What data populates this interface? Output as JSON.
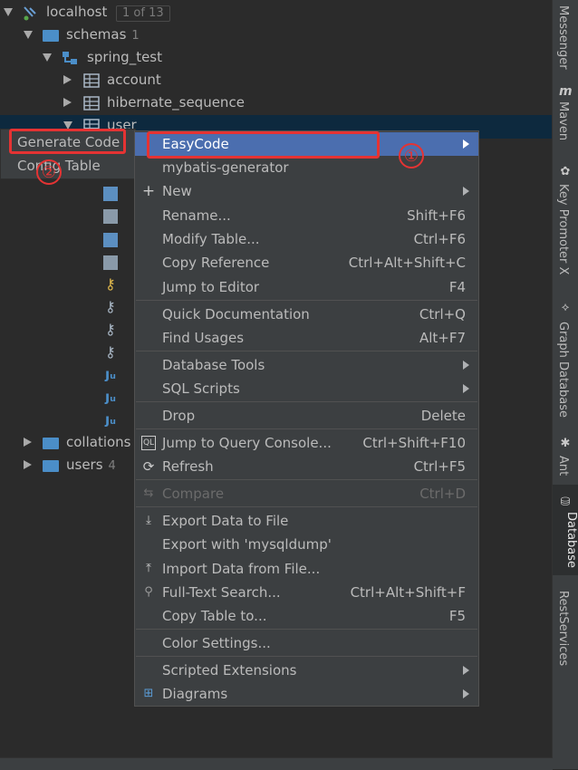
{
  "tree": {
    "root": {
      "label": "localhost",
      "badge": "1 of 13"
    },
    "schemas": {
      "label": "schemas",
      "count": "1"
    },
    "db": {
      "label": "spring_test"
    },
    "tables": [
      {
        "label": "account"
      },
      {
        "label": "hibernate_sequence"
      },
      {
        "label": "user"
      }
    ],
    "collations": {
      "label": "collations"
    },
    "users": {
      "label": "users",
      "count": "4"
    }
  },
  "submenu": {
    "items": [
      {
        "label": "Generate Code"
      },
      {
        "label": "Config Table"
      }
    ]
  },
  "menu": {
    "items": [
      {
        "label": "EasyCode",
        "submenu": true,
        "selected": true
      },
      {
        "label": "mybatis-generator"
      },
      {
        "label": "New",
        "submenu": true,
        "icon": "plus-icon"
      },
      {
        "label": "Rename...",
        "shortcut": "Shift+F6"
      },
      {
        "label": "Modify Table...",
        "shortcut": "Ctrl+F6"
      },
      {
        "label": "Copy Reference",
        "shortcut": "Ctrl+Alt+Shift+C"
      },
      {
        "label": "Jump to Editor",
        "shortcut": "F4"
      },
      {
        "label": "Quick Documentation",
        "shortcut": "Ctrl+Q"
      },
      {
        "label": "Find Usages",
        "shortcut": "Alt+F7"
      },
      {
        "label": "Database Tools",
        "submenu": true
      },
      {
        "label": "SQL Scripts",
        "submenu": true
      },
      {
        "label": "Drop",
        "shortcut": "Delete"
      },
      {
        "label": "Jump to Query Console...",
        "shortcut": "Ctrl+Shift+F10",
        "icon": "query-console-icon"
      },
      {
        "label": "Refresh",
        "shortcut": "Ctrl+F5",
        "icon": "refresh-icon"
      },
      {
        "label": "Compare",
        "shortcut": "Ctrl+D",
        "disabled": true,
        "icon": "compare-icon"
      },
      {
        "label": "Export Data to File",
        "icon": "export-icon"
      },
      {
        "label": "Export with 'mysqldump'"
      },
      {
        "label": "Import Data from File...",
        "icon": "import-icon"
      },
      {
        "label": "Full-Text Search...",
        "shortcut": "Ctrl+Alt+Shift+F",
        "icon": "search-icon"
      },
      {
        "label": "Copy Table to...",
        "shortcut": "F5"
      },
      {
        "label": "Color Settings..."
      },
      {
        "label": "Scripted Extensions",
        "submenu": true
      },
      {
        "label": "Diagrams",
        "submenu": true,
        "icon": "diagram-icon"
      }
    ]
  },
  "annotations": {
    "one": "①",
    "two": "②"
  },
  "toolstrip": [
    {
      "label": "Messenger"
    },
    {
      "label": "Maven",
      "icon": "m"
    },
    {
      "label": "Key Promoter X"
    },
    {
      "label": "Graph Database"
    },
    {
      "label": "Ant"
    },
    {
      "label": "Database",
      "active": true
    },
    {
      "label": "RestServices"
    }
  ],
  "colors": {
    "selection": "#4b6eaf",
    "annotation": "#e53333",
    "background": "#2b2b2b"
  }
}
